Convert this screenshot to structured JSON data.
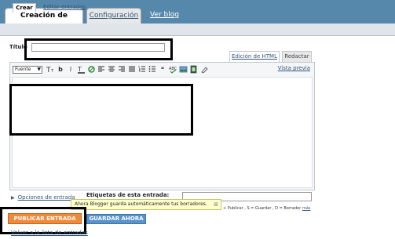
{
  "tabs": {
    "active": "Creación de entradas",
    "config": "Configuración",
    "view_blog": "Ver blog"
  },
  "subtabs": {
    "crear": "Crear",
    "editar": "Editar entradas"
  },
  "title_field": {
    "label": "Título",
    "value": ""
  },
  "editor_modes": {
    "html": "Edición de HTML",
    "compose": "Redactar"
  },
  "toolbar": {
    "font_select": "Fuente",
    "font_size_icon": "font-size-icon",
    "bold_label": "b",
    "italic_label": "i",
    "preview_link": "Vista previa"
  },
  "post_options_link": "Opciones de entrada",
  "labels_field": {
    "label": "Etiquetas de esta entrada:",
    "value": ""
  },
  "autosave_tooltip": "Ahora Blogger guarda automáticamente tus borradores.",
  "shortcuts": {
    "text": "+ Publicar , S = Guardar , D = Borrador",
    "more": "más"
  },
  "buttons": {
    "publish": "PUBLICAR ENTRADA",
    "save_now": "GUARDAR AHORA"
  },
  "back_link": "Volver a la lista de entradas",
  "colors": {
    "header_bg": "#5588aa",
    "publish_bg": "#f08a3b",
    "save_bg": "#5a93c9",
    "link": "#335577",
    "tooltip_bg": "#ffffcc"
  }
}
